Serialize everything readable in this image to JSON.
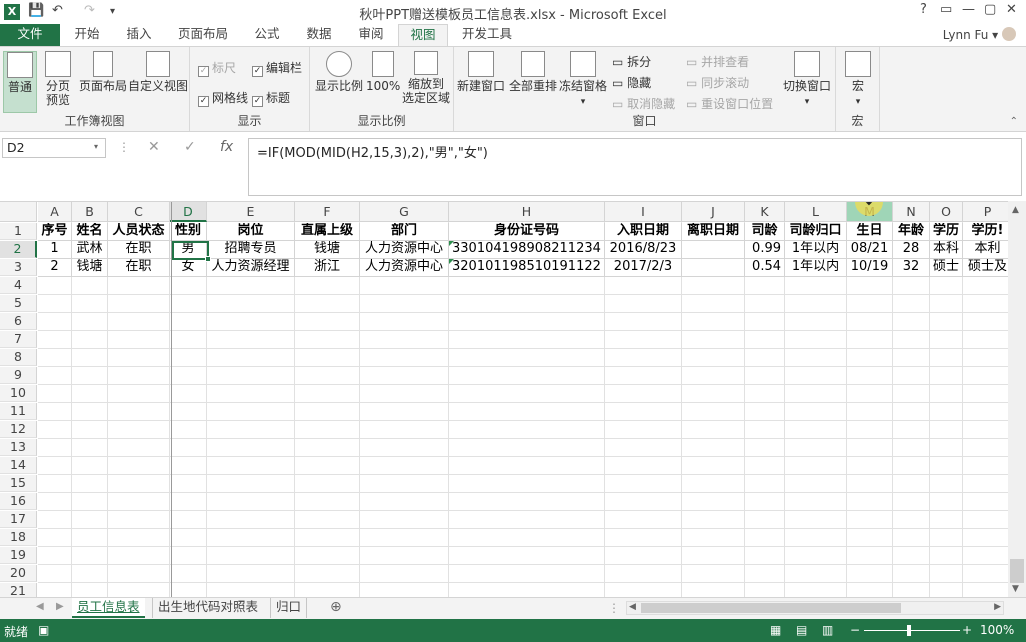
{
  "window": {
    "title": "秋叶PPT赠送模板员工信息表.xlsx - Microsoft Excel",
    "help": "?",
    "user": "Lynn Fu"
  },
  "tabs": [
    "文件",
    "开始",
    "插入",
    "页面布局",
    "公式",
    "数据",
    "审阅",
    "视图",
    "开发工具"
  ],
  "ribbon": {
    "views": {
      "normal": "普通",
      "pagebreak1": "分页",
      "pagebreak2": "预览",
      "pagelayout": "页面布局",
      "custom": "自定义视图",
      "label": "工作簿视图"
    },
    "show": {
      "ruler": "标尺",
      "formulabar": "编辑栏",
      "gridlines": "网格线",
      "headings": "标题",
      "label": "显示"
    },
    "zoom": {
      "zoom": "显示比例",
      "hundred": "100%",
      "zoomsel1": "缩放到",
      "zoomsel2": "选定区域",
      "label": "显示比例"
    },
    "window": {
      "newwin": "新建窗口",
      "arrange": "全部重排",
      "freeze": "冻结窗格",
      "split": "拆分",
      "hide": "隐藏",
      "unhide": "取消隐藏",
      "sidebyside": "并排查看",
      "syncscroll": "同步滚动",
      "reset": "重设窗口位置",
      "switch": "切换窗口",
      "label": "窗口"
    },
    "macro": {
      "macro": "宏",
      "label": "宏"
    }
  },
  "formula_bar": {
    "namebox": "D2",
    "formula": "=IF(MOD(MID(H2,15,3),2),\"男\",\"女\")"
  },
  "columns": [
    "A",
    "B",
    "C",
    "D",
    "E",
    "F",
    "G",
    "H",
    "I",
    "J",
    "K",
    "L",
    "M",
    "N",
    "O",
    "P"
  ],
  "rows": [
    "1",
    "2",
    "3",
    "4",
    "5",
    "6",
    "7",
    "8",
    "9",
    "10",
    "11",
    "12",
    "13",
    "14",
    "15",
    "16",
    "17",
    "18",
    "19",
    "20",
    "21"
  ],
  "table": {
    "header": [
      "序号",
      "姓名",
      "人员状态",
      "性别",
      "岗位",
      "直属上级",
      "部门",
      "身份证号码",
      "入职日期",
      "离职日期",
      "司龄",
      "司龄归口",
      "生日",
      "年龄",
      "学历",
      "学历!"
    ],
    "rows": [
      [
        "1",
        "武林",
        "在职",
        "男",
        "招聘专员",
        "钱塘",
        "人力资源中心",
        "330104198908211234",
        "2016/8/23",
        "",
        "0.99",
        "1年以内",
        "08/21",
        "28",
        "本科",
        "本利"
      ],
      [
        "2",
        "钱塘",
        "在职",
        "女",
        "人力资源经理",
        "浙江",
        "人力资源中心",
        "320101198510191122",
        "2017/2/3",
        "",
        "0.54",
        "1年以内",
        "10/19",
        "32",
        "硕士",
        "硕士及"
      ]
    ]
  },
  "sheets": [
    "员工信息表",
    "出生地代码对照表",
    "归口"
  ],
  "status": {
    "ready": "就绪",
    "zoom": "100%"
  }
}
